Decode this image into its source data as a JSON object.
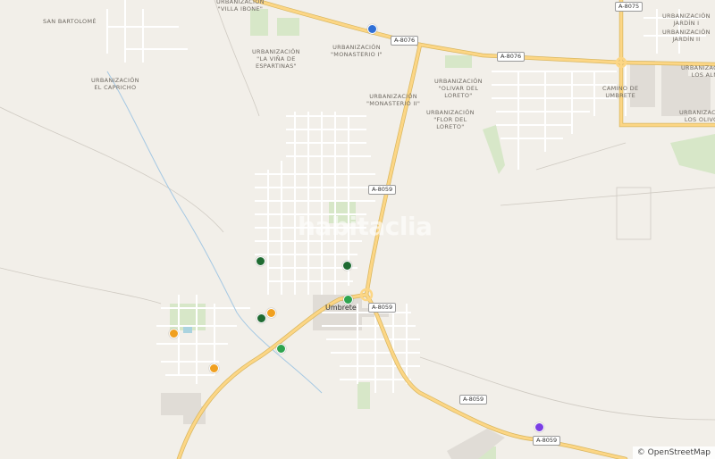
{
  "watermark": "habitaclia",
  "attribution": "© OpenStreetMap",
  "town_name": "Umbrete",
  "place_labels": [
    {
      "id": "san-bartolome",
      "text": "SAN BARTOLOMÉ"
    },
    {
      "id": "villa-ibone",
      "text": "URBANIZACIÓN\n\"VILLA IBONE\""
    },
    {
      "id": "el-capricho",
      "text": "URBANIZACIÓN\nEL CAPRICHO"
    },
    {
      "id": "vina-espartinas",
      "text": "URBANIZACIÓN\n\"LA VIÑA DE\nESPARTINAS\""
    },
    {
      "id": "monasterio-1",
      "text": "URBANIZACIÓN\n\"MONASTERIO I\""
    },
    {
      "id": "monasterio-2",
      "text": "URBANIZACIÓN\n\"MONASTERIO II\""
    },
    {
      "id": "olivar-loreto",
      "text": "URBANIZACIÓN\n\"OLIVAR DEL\nLORETO\""
    },
    {
      "id": "flor-loreto",
      "text": "URBANIZACIÓN\n\"FLOR DEL\nLORETO\""
    },
    {
      "id": "camino-umbrete",
      "text": "CAMINO DE\nUMBRETE"
    },
    {
      "id": "jardin-1",
      "text": "URBANIZACIÓN\nJARDÍN I"
    },
    {
      "id": "jardin-2",
      "text": "URBANIZACIÓN\nJARDÍN II"
    },
    {
      "id": "los-alm",
      "text": "URBANIZACIÓN\nLOS ALM"
    },
    {
      "id": "los-olivos",
      "text": "URBANIZACIÓN\nLOS OLIVOS"
    }
  ],
  "road_labels": [
    {
      "id": "a8075",
      "text": "A-8075"
    },
    {
      "id": "a8076-a",
      "text": "A-8076"
    },
    {
      "id": "a8076-b",
      "text": "A-8076"
    },
    {
      "id": "a8059-n",
      "text": "A-8059"
    },
    {
      "id": "a8059-c",
      "text": "A-8059"
    },
    {
      "id": "a8059-s",
      "text": "A-8059"
    },
    {
      "id": "a8059-se",
      "text": "A-8059"
    }
  ],
  "markers": [
    {
      "id": "blue",
      "color": "#2f6fd6"
    },
    {
      "id": "green-dark-1",
      "color": "#1f6b32"
    },
    {
      "id": "green-dark-2",
      "color": "#1f6b32"
    },
    {
      "id": "green-dark-3",
      "color": "#1f6b32"
    },
    {
      "id": "green-1",
      "color": "#2ea44f"
    },
    {
      "id": "green-2",
      "color": "#2ea44f"
    },
    {
      "id": "orange-1",
      "color": "#f0a020"
    },
    {
      "id": "orange-2",
      "color": "#f0a020"
    },
    {
      "id": "orange-3",
      "color": "#f0a020"
    },
    {
      "id": "purple",
      "color": "#7b3fe4"
    }
  ]
}
